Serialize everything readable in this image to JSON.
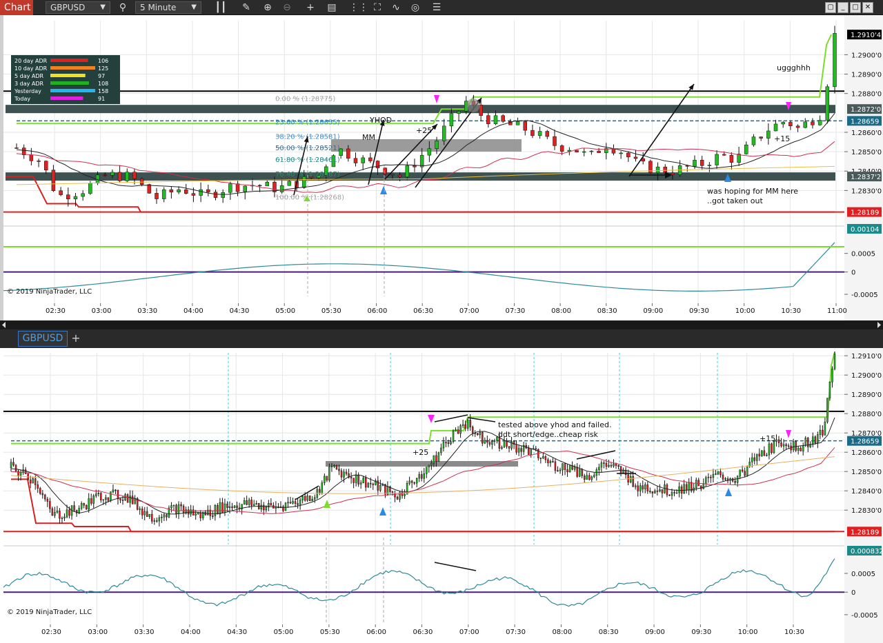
{
  "toolbar": {
    "chart_label": "Chart",
    "instrument": "GBPUSD",
    "timeframe": "5 Minute",
    "icons": [
      "bar-style-icon",
      "draw-pencil-icon",
      "zoom-in-icon",
      "zoom-out-icon",
      "crosshair-icon",
      "data-box-icon",
      "indicators-icon",
      "strategies-icon",
      "chart-trader-icon",
      "properties-icon"
    ],
    "window_buttons": [
      "restore",
      "minimize",
      "maximize",
      "close"
    ]
  },
  "adr_table": [
    {
      "label": "20 day ADR",
      "value": "106",
      "color": "#e02020",
      "frac": 0.84
    },
    {
      "label": "10 day ADR",
      "value": "125",
      "color": "#f08020",
      "frac": 1.0
    },
    {
      "label": "5 day ADR",
      "value": "97",
      "color": "#f0e020",
      "frac": 0.78
    },
    {
      "label": "3 day ADR",
      "value": "108",
      "color": "#20b020",
      "frac": 0.86
    },
    {
      "label": "Yesterday",
      "value": "158",
      "color": "#20b8f0",
      "frac": 1.0
    },
    {
      "label": "Today",
      "value": "91",
      "color": "#e020e0",
      "frac": 0.73
    }
  ],
  "panel1": {
    "price_labels": [
      "1.2900'0",
      "1.2890'0",
      "1.2880'0",
      "1.2860'0",
      "1.2850'0",
      "1.2840'0",
      "1.2830'0"
    ],
    "price_values": [
      1.29,
      1.289,
      1.288,
      1.286,
      1.285,
      1.284,
      1.283
    ],
    "price_range": [
      1.28145,
      1.2914
    ],
    "tags": [
      {
        "text": "1.2910'4",
        "value": 1.29104,
        "bg": "#000000",
        "fg": "#ffffff"
      },
      {
        "text": "1.2872'0",
        "value": 1.2872,
        "bg": "#4a5a5a",
        "fg": "#ffffff"
      },
      {
        "text": "1.28659",
        "value": 1.28659,
        "bg": "#1a6a8a",
        "fg": "#ffffff"
      },
      {
        "text": "1.2837'2",
        "value": 1.28372,
        "bg": "#4a5a5a",
        "fg": "#ffffff"
      },
      {
        "text": "1.28189",
        "value": 1.28189,
        "bg": "#e02020",
        "fg": "#ffffff"
      }
    ],
    "fib_levels": [
      {
        "text": "0.00 % (1.28775)",
        "value": 1.28775,
        "color": "#a0a0a0"
      },
      {
        "text": "23.60 % (1.28655)",
        "value": 1.28655,
        "color": "#3a8fd8"
      },
      {
        "text": "38.20 % (1.28581)",
        "value": 1.28581,
        "color": "#3a8fd8"
      },
      {
        "text": "50.00 % (1.28521)",
        "value": 1.28521,
        "color": "#3a6a8a"
      },
      {
        "text": "61.80 % (1.28461)",
        "value": 1.28461,
        "color": "#2a8a8a"
      },
      {
        "text": "76.40 % (1.28387)",
        "value": 1.28387,
        "color": "#2a8a6a"
      },
      {
        "text": "100.00 % (1.28268)",
        "value": 1.28268,
        "color": "#a0a0a0"
      }
    ],
    "annotations": [
      {
        "text": "YHOD"
      },
      {
        "text": "MM"
      },
      {
        "text": "+25"
      },
      {
        "text": "uggghhh"
      },
      {
        "text": "+15"
      },
      {
        "text": "was hoping for MM here"
      },
      {
        "text": "..got taken out"
      }
    ],
    "osc_labels": [
      "0.0005",
      "0",
      "-0.0005"
    ],
    "osc_tag": "0.00104",
    "copyright": "© 2019 NinjaTrader, LLC",
    "time_labels": [
      "02:30",
      "03:00",
      "03:30",
      "04:00",
      "04:30",
      "05:00",
      "05:30",
      "06:00",
      "06:30",
      "07:00",
      "07:30",
      "08:00",
      "08:30",
      "09:00",
      "09:30",
      "10:00",
      "10:30",
      "11:00"
    ]
  },
  "tab": {
    "label": "GBPUSD",
    "add": "+"
  },
  "panel2": {
    "price_labels": [
      "1.2910'0",
      "1.2900'0",
      "1.2890'0",
      "1.2880'0",
      "1.2870'0",
      "1.2860'0",
      "1.2850'0",
      "1.2840'0",
      "1.2830'0"
    ],
    "price_values": [
      1.291,
      1.29,
      1.289,
      1.288,
      1.287,
      1.286,
      1.285,
      1.284,
      1.283
    ],
    "price_range": [
      1.28165,
      1.29115
    ],
    "tags": [
      {
        "text": "1.28659",
        "value": 1.28659,
        "bg": "#1a6a8a",
        "fg": "#ffffff"
      },
      {
        "text": "1.28189",
        "value": 1.28189,
        "bg": "#e02020",
        "fg": "#ffffff"
      }
    ],
    "annotations": [
      {
        "text": "tested above yhod and failed."
      },
      {
        "text": "ddt short/edge..cheap risk"
      },
      {
        "text": "+25"
      },
      {
        "text": "+15"
      }
    ],
    "osc_labels": [
      "0.0005",
      "0",
      "-0.0005"
    ],
    "osc_tag": "0.000832",
    "copyright": "© 2019 NinjaTrader, LLC",
    "time_labels": [
      "02:30",
      "03:00",
      "03:30",
      "04:00",
      "04:30",
      "05:00",
      "05:30",
      "06:00",
      "06:30",
      "07:00",
      "07:30",
      "08:00",
      "08:30",
      "09:00",
      "09:30",
      "10:00",
      "10:30"
    ]
  }
}
